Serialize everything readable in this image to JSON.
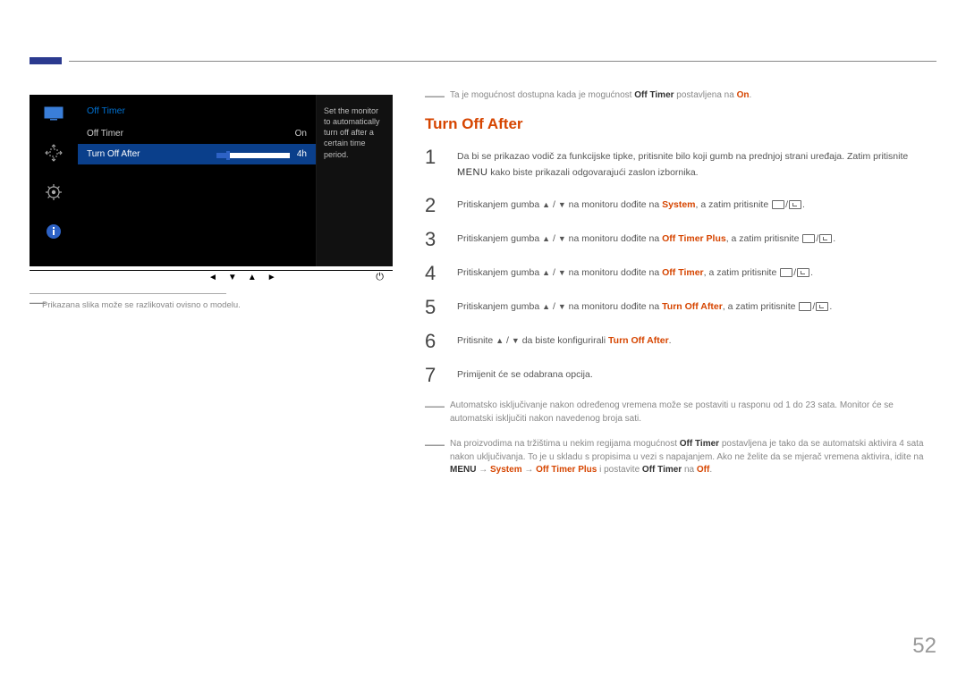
{
  "osd": {
    "title": "Off Timer",
    "rows": [
      {
        "label": "Off Timer",
        "value": "On",
        "selected": false
      },
      {
        "label": "Turn Off After",
        "value": "4h",
        "selected": true
      }
    ],
    "hint": "Set the monitor to automatically turn off after a certain time period.",
    "sidebar_icons": [
      "monitor-icon",
      "move-icon",
      "gear-icon",
      "info-icon"
    ]
  },
  "caption": "Prikazana slika može se razlikovati ovisno o modelu.",
  "top_note": {
    "pre": "Ta je mogućnost dostupna kada je mogućnost ",
    "bold1": "Off Timer",
    "mid": " postavljena na ",
    "red1": "On",
    "post": "."
  },
  "heading": "Turn Off After",
  "steps": {
    "s1a": "Da bi se prikazao vodič za funkcijske tipke, pritisnite bilo koji gumb na prednjoj strani uređaja. Zatim pritisnite ",
    "s1menu": "MENU",
    "s1b": " kako biste prikazali odgovarajući zaslon izbornika.",
    "s2a": "Pritiskanjem gumba ",
    "s2b": " na monitoru dođite na ",
    "s2target": "System",
    "s2c": ", a zatim pritisnite ",
    "s3target": "Off Timer Plus",
    "s4target": "Off Timer",
    "s5target": "Turn Off After",
    "s6a": "Pritisnite ",
    "s6b": " da biste konfigurirali ",
    "s6target": "Turn Off After",
    "s7": "Primijenit će se odabrana opcija."
  },
  "footnotes": {
    "f1": "Automatsko isključivanje nakon određenog vremena može se postaviti u rasponu od 1 do 23 sata. Monitor će se automatski isključiti nakon navedenog broja sati.",
    "f2a": "Na proizvodima na tržištima u nekim regijama mogućnost ",
    "f2_off_timer": "Off Timer",
    "f2b": " postavljena je tako da se automatski aktivira 4 sata nakon uključivanja. To je u skladu s propisima u vezi s napajanjem. Ako ne želite da se mjerač vremena aktivira, idite na ",
    "f2_menu": "MENU",
    "f2_arrow": " → ",
    "f2_system": "System",
    "f2_otp": "Off Timer Plus",
    "f2c": " i postavite ",
    "f2_ot2": "Off Timer",
    "f2d": " na ",
    "f2_off": "Off",
    "f2e": "."
  },
  "page_number": "52"
}
